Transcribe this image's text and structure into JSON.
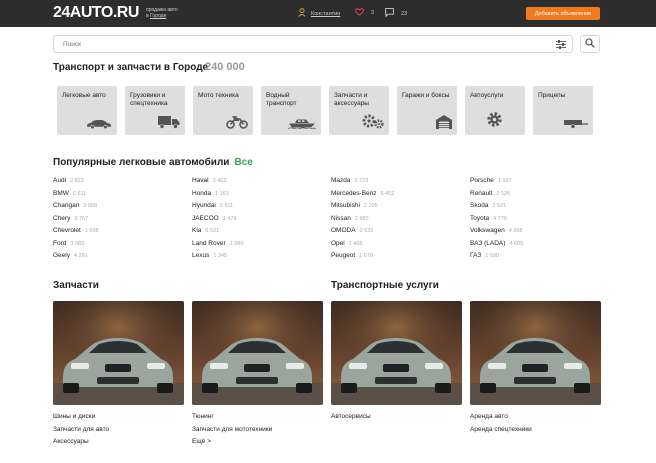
{
  "header": {
    "logo": "24AUTO.RU",
    "tagline_line1": "продажа авто",
    "tagline_prefix": "в ",
    "tagline_city": "Городе",
    "user_name": "Константин",
    "favorites_count": "3",
    "messages_count": "23",
    "add_button": "Добавить объявление"
  },
  "search": {
    "placeholder": "Поиск"
  },
  "page": {
    "title": "Транспорт и запчасти в Городе",
    "count": "240 000"
  },
  "categories": [
    {
      "label": "Легковые авто",
      "icon": "car-icon"
    },
    {
      "label": "Грузовики и спецтехника",
      "icon": "truck-icon"
    },
    {
      "label": "Мото техника",
      "icon": "motorcycle-icon"
    },
    {
      "label": "Водный транспорт",
      "icon": "boat-icon"
    },
    {
      "label": "Запчасти и аксессуары",
      "icon": "gears-icon"
    },
    {
      "label": "Гаражи и боксы",
      "icon": "garage-icon"
    },
    {
      "label": "Автоуслуги",
      "icon": "gear-icon"
    },
    {
      "label": "Прицепы",
      "icon": "trailer-icon"
    }
  ],
  "popular": {
    "title": "Популярные легковые автомобили",
    "all": "Все"
  },
  "brands": [
    [
      {
        "name": "Audi",
        "count": "2 823"
      },
      {
        "name": "BMW",
        "count": "6 511"
      },
      {
        "name": "Changan",
        "count": "3 808"
      },
      {
        "name": "Chery",
        "count": "3 767"
      },
      {
        "name": "Chevrolet",
        "count": "1 698"
      },
      {
        "name": "Ford",
        "count": "3 083"
      },
      {
        "name": "Geely",
        "count": "4 291"
      }
    ],
    [
      {
        "name": "Haval",
        "count": "3 463"
      },
      {
        "name": "Honda",
        "count": "1 162"
      },
      {
        "name": "Hyundai",
        "count": "5 611"
      },
      {
        "name": "JAECOO",
        "count": "1 479"
      },
      {
        "name": "Kia",
        "count": "6 531"
      },
      {
        "name": "Land Rover",
        "count": "1 586"
      },
      {
        "name": "Lexus",
        "count": "1 345"
      }
    ],
    [
      {
        "name": "Mazda",
        "count": "1 723"
      },
      {
        "name": "Mercedes-Benz",
        "count": "6 452"
      },
      {
        "name": "Mitsubishi",
        "count": "2 205"
      },
      {
        "name": "Nissan",
        "count": "2 982"
      },
      {
        "name": "OMODA",
        "count": "2 535"
      },
      {
        "name": "Opel",
        "count": "1 466"
      },
      {
        "name": "Peugeot",
        "count": "1 070"
      }
    ],
    [
      {
        "name": "Porsche",
        "count": "1 167"
      },
      {
        "name": "Renault",
        "count": "2 126"
      },
      {
        "name": "Skoda",
        "count": "2 521"
      },
      {
        "name": "Toyota",
        "count": "4 776"
      },
      {
        "name": "Volkswagen",
        "count": "4 368"
      },
      {
        "name": "ВАЗ (LADA)",
        "count": "4 605"
      },
      {
        "name": "ГАЗ",
        "count": "1 530"
      }
    ]
  ],
  "parts": {
    "title": "Запчасти",
    "col1": [
      "Шины и диски",
      "Запчасти для авто",
      "Аксессуары"
    ],
    "col2": [
      "Тюнинг",
      "Запчасти для мототехники",
      "Ещё >"
    ]
  },
  "transport_services": {
    "title": "Транспортные услуги",
    "col1": [
      "Автосервисы"
    ],
    "col2": [
      "Аренда авто",
      "Аренда спецтехники"
    ]
  },
  "colors": {
    "header_bg": "#2d2d2d",
    "accent_orange": "#f07b1e",
    "accent_green": "#3aa64a",
    "tile_bg": "#dedede"
  }
}
